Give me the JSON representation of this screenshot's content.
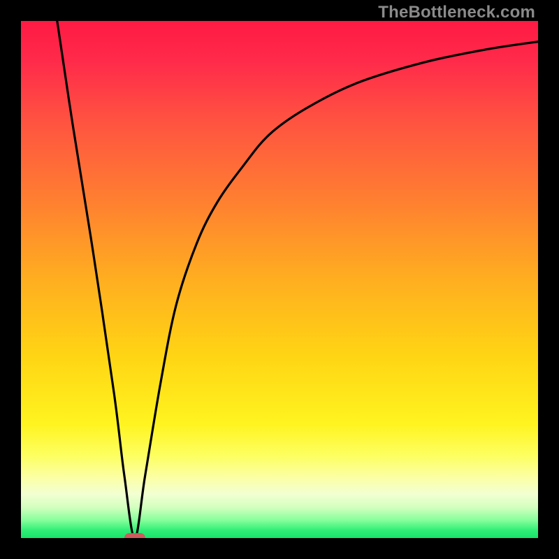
{
  "watermark": "TheBottleneck.com",
  "chart_data": {
    "type": "line",
    "title": "",
    "xlabel": "",
    "ylabel": "",
    "xlim": [
      0,
      100
    ],
    "ylim": [
      0,
      100
    ],
    "series": [
      {
        "name": "bottleneck-curve",
        "x": [
          7,
          10,
          14,
          18,
          20,
          22,
          24,
          27,
          30,
          34,
          38,
          43,
          48,
          55,
          65,
          78,
          90,
          100
        ],
        "values": [
          100,
          80,
          55,
          28,
          12,
          0,
          12,
          30,
          45,
          57,
          65,
          72,
          78,
          83,
          88,
          92,
          94.5,
          96
        ]
      }
    ],
    "annotations": [
      {
        "name": "optimal-marker",
        "x": 22,
        "y": 0,
        "shape": "rounded-rect",
        "color": "#cd5c5c"
      }
    ],
    "background_gradient_stops": [
      {
        "offset": 0.0,
        "color": "#ff1a44"
      },
      {
        "offset": 0.08,
        "color": "#ff2b4a"
      },
      {
        "offset": 0.2,
        "color": "#ff5540"
      },
      {
        "offset": 0.35,
        "color": "#ff8030"
      },
      {
        "offset": 0.5,
        "color": "#ffae20"
      },
      {
        "offset": 0.65,
        "color": "#ffd514"
      },
      {
        "offset": 0.78,
        "color": "#fff420"
      },
      {
        "offset": 0.84,
        "color": "#fdff60"
      },
      {
        "offset": 0.885,
        "color": "#fbffa8"
      },
      {
        "offset": 0.915,
        "color": "#f2ffd2"
      },
      {
        "offset": 0.94,
        "color": "#d4ffc0"
      },
      {
        "offset": 0.965,
        "color": "#88ff9c"
      },
      {
        "offset": 0.985,
        "color": "#30f076"
      },
      {
        "offset": 1.0,
        "color": "#18e46b"
      }
    ]
  }
}
